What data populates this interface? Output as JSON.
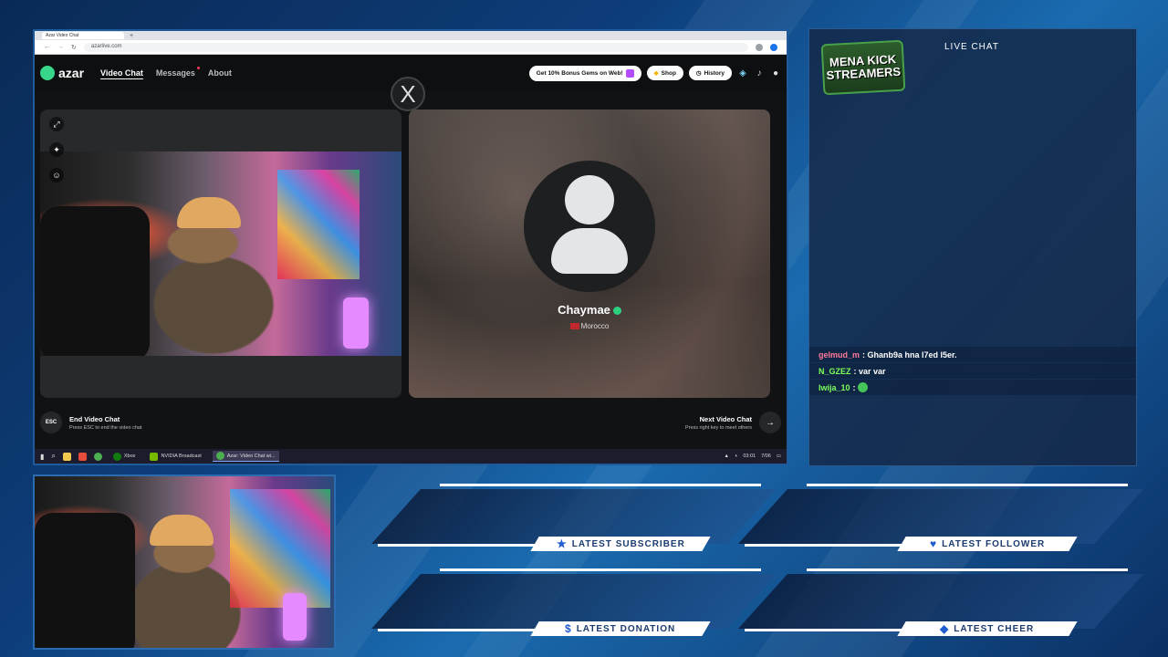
{
  "browser": {
    "tab_title": "Azar Video Chat",
    "url": "azarlive.com"
  },
  "azar": {
    "logo": "azar",
    "nav": [
      {
        "label": "Video Chat",
        "active": true
      },
      {
        "label": "Messages",
        "badge": true
      },
      {
        "label": "About"
      }
    ],
    "promo_pill": "Get 10% Bonus Gems on Web!",
    "shop_label": "Shop",
    "history_label": "History",
    "peer": {
      "name": "Chaymae",
      "country": "Morocco"
    },
    "end_chat": {
      "key": "ESC",
      "title": "End Video Chat",
      "subtitle": "Press ESC to end the video chat"
    },
    "next_chat": {
      "title": "Next Video Chat",
      "subtitle": "Press right key to meet others"
    }
  },
  "taskbar": {
    "items": [
      "Xbox",
      "NVIDIA Broadcast",
      "Azar: Video Chat wi..."
    ],
    "time": "03:01",
    "date": "7/06"
  },
  "chat": {
    "logo_line1": "MENA KICK",
    "logo_line2": "STREAMERS",
    "title": "LIVE CHAT",
    "messages": [
      {
        "user": "gelmud_m",
        "color": "#ff7a9a",
        "text": ": Ghanb9a hna l7ed l5er."
      },
      {
        "user": "N_GZEZ",
        "color": "#7cff5a",
        "text": ": var var"
      },
      {
        "user": "lwija_10",
        "color": "#7cff5a",
        "text": ":",
        "emote": true
      }
    ]
  },
  "alerts": {
    "subscriber": {
      "label": "LATEST SUBSCRIBER",
      "icon": "star-icon"
    },
    "follower": {
      "label": "LATEST FOLLOWER",
      "icon": "heart-icon"
    },
    "donation": {
      "label": "LATEST DONATION",
      "icon": "dollar-icon"
    },
    "cheer": {
      "label": "LATEST CHEER",
      "icon": "diamond-icon"
    }
  },
  "colors": {
    "accent_blue": "#1f5dd0",
    "azar_green": "#37d68a"
  }
}
